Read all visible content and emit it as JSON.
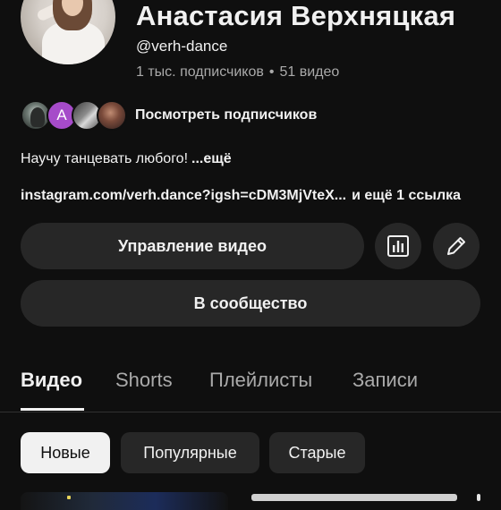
{
  "channel": {
    "name": "Анастасия Верхняцкая",
    "handle": "@verh-dance",
    "subscribers": "1 тыс. подписчиков",
    "separator": "•",
    "videos": "51 видео"
  },
  "subscribers_preview": {
    "avatar_letter": "A",
    "avatar_letter_color": "#a64bc9",
    "label": "Посмотреть подписчиков"
  },
  "description": {
    "text": "Научу танцевать любого!",
    "more": "...ещё"
  },
  "links": {
    "url": "instagram.com/verh.dance?igsh=cDM3MjVteX...",
    "extra": "и ещё 1 ссылка"
  },
  "actions": {
    "manage_videos": "Управление видео",
    "analytics_icon": "bar-chart-icon",
    "edit_icon": "pencil-icon",
    "community": "В сообщество"
  },
  "tabs": [
    {
      "label": "Видео",
      "active": true
    },
    {
      "label": "Shorts",
      "active": false
    },
    {
      "label": "Плейлисты",
      "active": false
    },
    {
      "label": "Записи",
      "active": false
    }
  ],
  "filters": [
    {
      "label": "Новые",
      "selected": true
    },
    {
      "label": "Популярные",
      "selected": false
    },
    {
      "label": "Старые",
      "selected": false
    }
  ],
  "colors": {
    "background": "#0f0f0f",
    "surface": "#272727",
    "text": "#f1f1f1",
    "secondary_text": "#aaaaaa"
  }
}
